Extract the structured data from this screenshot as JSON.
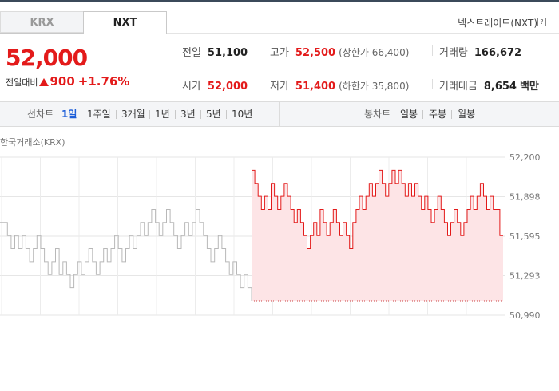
{
  "tabs": [
    {
      "label": "KRX",
      "active": false
    },
    {
      "label": "NXT",
      "active": true
    }
  ],
  "market_label": "넥스트레이드(NXT)",
  "help_icon": "?",
  "price": {
    "current": "52,000",
    "change_label": "전일대비",
    "direction": "up",
    "change_amount": "900",
    "change_percent": "+1.76%"
  },
  "stats": {
    "prev_close": {
      "label": "전일",
      "value": "51,100"
    },
    "open": {
      "label": "시가",
      "value": "52,000"
    },
    "high": {
      "label": "고가",
      "value": "52,500",
      "sub": "(상한가 66,400)"
    },
    "low": {
      "label": "저가",
      "value": "51,400",
      "sub": "(하한가 35,800)"
    },
    "volume": {
      "label": "거래량",
      "value": "166,672"
    },
    "trade_value": {
      "label": "거래대금",
      "value": "8,654",
      "unit": "백만"
    }
  },
  "line_chart_tabs": {
    "label": "선차트",
    "items": [
      "1일",
      "1주일",
      "3개월",
      "1년",
      "3년",
      "5년",
      "10년"
    ],
    "active": "1일"
  },
  "candle_chart_tabs": {
    "label": "봉차트",
    "items": [
      "일봉",
      "주봉",
      "월봉"
    ]
  },
  "colors": {
    "up": "#e31a1a",
    "accent": "#1e5fd9",
    "krx_line": "#b8b8b8",
    "nxt_fill": "#fde4e6"
  },
  "chart_data": {
    "type": "line",
    "title": "한국거래소(KRX)",
    "y_ticks": [
      "52,200",
      "51,898",
      "51,595",
      "51,293",
      "50,990"
    ],
    "ylim": [
      50990,
      52200
    ],
    "grid": true,
    "reference_line": 51100,
    "series": [
      {
        "name": "KRX",
        "values": [
          51700,
          51700,
          51600,
          51500,
          51600,
          51500,
          51600,
          51500,
          51400,
          51500,
          51600,
          51500,
          51400,
          51300,
          51400,
          51500,
          51300,
          51400,
          51300,
          51200,
          51300,
          51400,
          51300,
          51400,
          51500,
          51400,
          51300,
          51400,
          51500,
          51400,
          51500,
          51600,
          51500,
          51400,
          51500,
          51600,
          51500,
          51600,
          51700,
          51600,
          51700,
          51800,
          51700,
          51600,
          51700,
          51800,
          51700,
          51600,
          51500,
          51600,
          51700,
          51600,
          51700,
          51800,
          51700,
          51600,
          51500,
          51400,
          51500,
          51600,
          51500,
          51400,
          51300,
          51400,
          51300,
          51200,
          51300,
          51200
        ]
      },
      {
        "name": "NXT",
        "values": [
          52100,
          52000,
          51900,
          51800,
          51900,
          51800,
          52000,
          51900,
          51800,
          51900,
          52000,
          51900,
          51800,
          51700,
          51800,
          51700,
          51600,
          51500,
          51600,
          51700,
          51600,
          51800,
          51700,
          51600,
          51700,
          51800,
          51700,
          51600,
          51700,
          51600,
          51500,
          51700,
          51800,
          51900,
          51800,
          51900,
          52000,
          51900,
          52000,
          52100,
          52000,
          51900,
          52000,
          52100,
          52000,
          52100,
          52000,
          51900,
          52000,
          51900,
          52000,
          51900,
          51800,
          51900,
          51800,
          51700,
          51800,
          51900,
          51800,
          51700,
          51600,
          51700,
          51800,
          51700,
          51600,
          51700,
          51800,
          51900,
          51800,
          51900,
          52000,
          51900,
          51800,
          51900,
          51800,
          51800,
          51600
        ]
      }
    ]
  }
}
